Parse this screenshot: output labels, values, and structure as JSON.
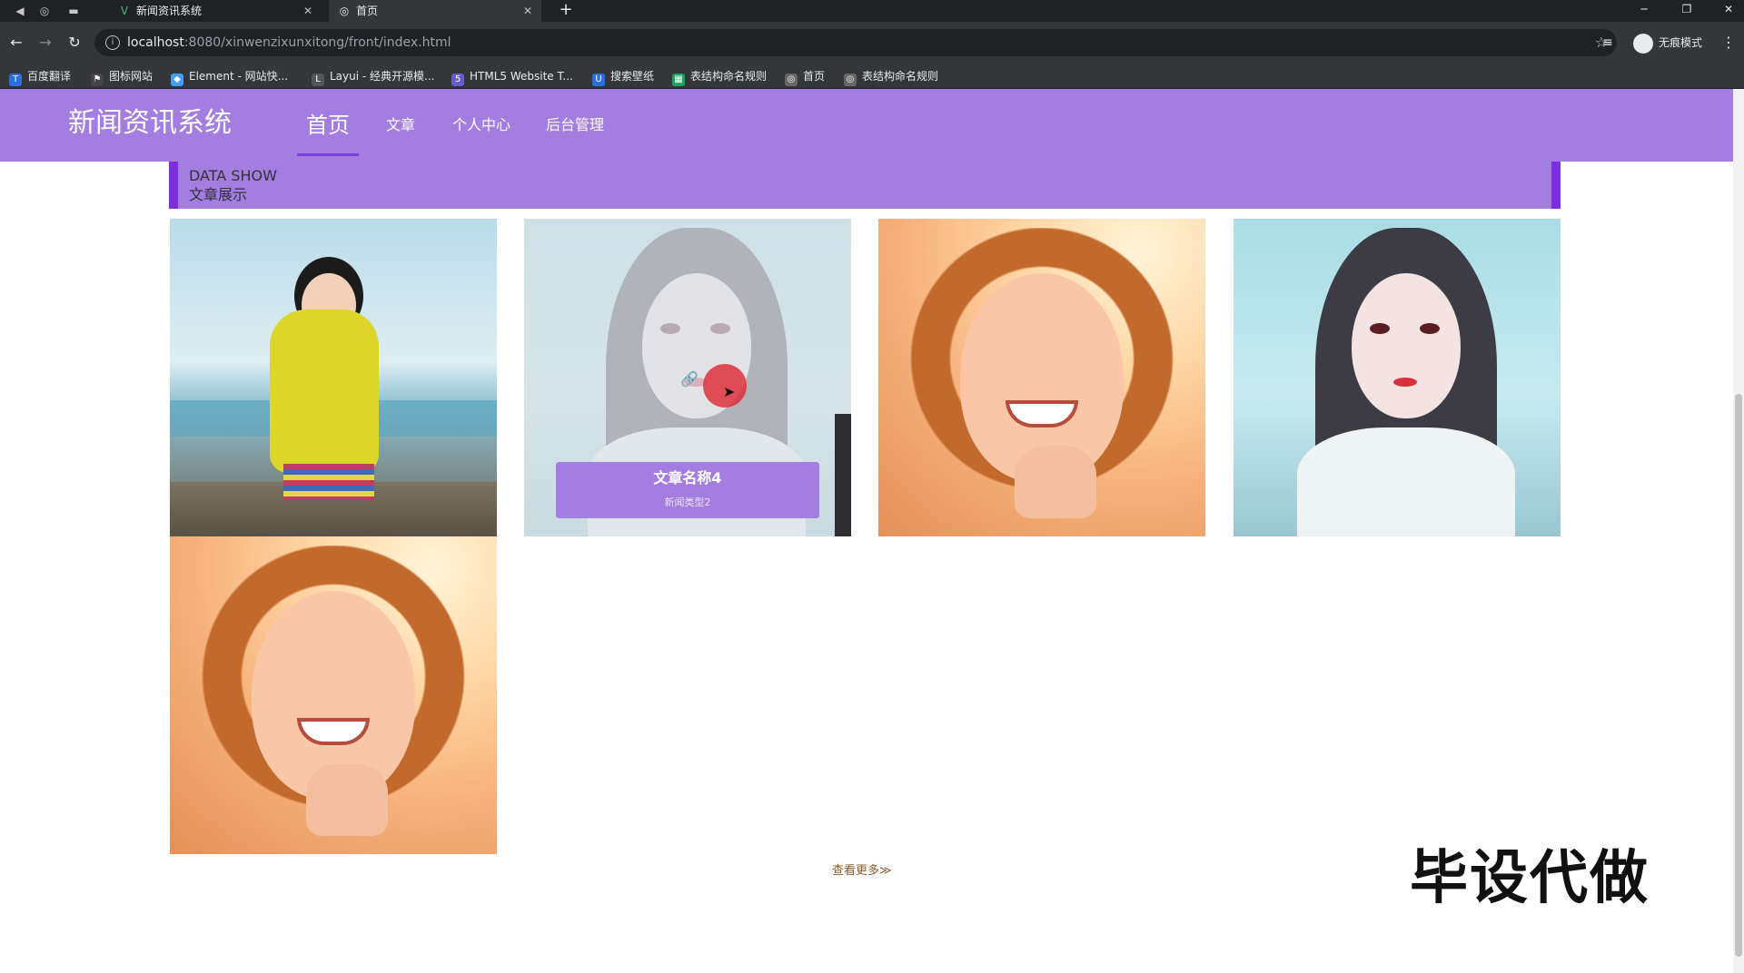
{
  "browser": {
    "tabs": [
      {
        "title": "新闻资讯系统",
        "favicon": "vue-icon"
      },
      {
        "title": "首页",
        "favicon": "globe-icon"
      }
    ],
    "url_host": "localhost",
    "url_path": ":8080/xinwenzixunxitong/front/index.html",
    "incognito_label": "无痕模式",
    "bookmarks": [
      {
        "label": "百度翻译",
        "color": "#2b6fe6"
      },
      {
        "label": "图标网站",
        "color": "#444444"
      },
      {
        "label": "Element - 网站快...",
        "color": "#409eff"
      },
      {
        "label": "Layui - 经典开源模...",
        "color": "#555555"
      },
      {
        "label": "HTML5 Website T...",
        "color": "#6a5acd"
      },
      {
        "label": "搜索壁纸",
        "color": "#2b6fe6"
      },
      {
        "label": "表结构命名规则",
        "color": "#1aa260"
      },
      {
        "label": "首页",
        "color": "#666666"
      },
      {
        "label": "表结构命名规则",
        "color": "#666666"
      }
    ]
  },
  "header": {
    "brand": "新闻资讯系统",
    "nav": [
      "首页",
      "文章",
      "个人中心",
      "后台管理"
    ],
    "active_index": 0,
    "color": "#a37de0"
  },
  "section": {
    "title_en": "DATA SHOW",
    "title_cn": "文章展示"
  },
  "gallery": {
    "hovered_caption": {
      "title": "文章名称4",
      "type": "新闻类型2"
    }
  },
  "more_link": "查看更多≫",
  "watermark": "毕设代做"
}
